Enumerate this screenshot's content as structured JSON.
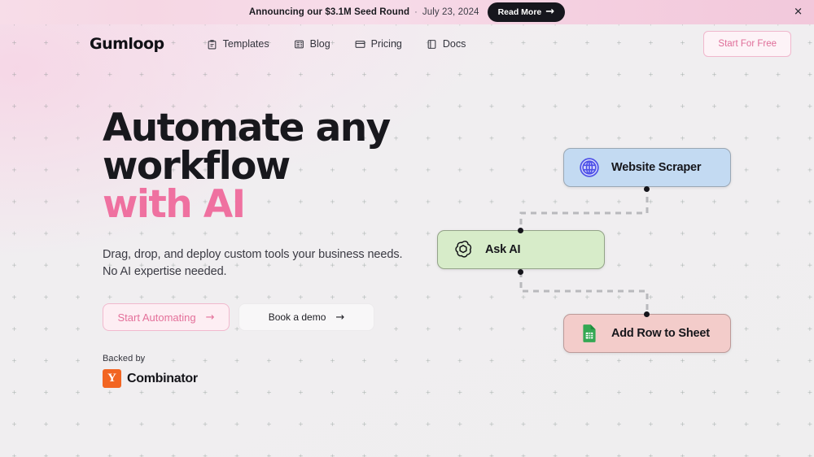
{
  "banner": {
    "text": "Announcing our $3.1M Seed Round",
    "separator": "·",
    "date": "July 23, 2024",
    "cta_label": "Read More",
    "cta_arrow": "→",
    "close_label": "✕"
  },
  "nav": {
    "logo": "Gumloop",
    "links": [
      {
        "label": "Templates",
        "icon": "clipboard-icon"
      },
      {
        "label": "Blog",
        "icon": "newspaper-icon"
      },
      {
        "label": "Pricing",
        "icon": "credit-card-icon"
      },
      {
        "label": "Docs",
        "icon": "book-icon"
      }
    ],
    "cta_label": "Start For Free"
  },
  "hero": {
    "headline_line1": "Automate any",
    "headline_line2": "workflow",
    "headline_accent": "with AI",
    "subhead_line1": "Drag, drop, and deploy custom tools your business needs.",
    "subhead_line2": "No AI expertise needed.",
    "primary_cta": "Start Automating",
    "primary_cta_arrow": "→",
    "secondary_cta": "Book a demo",
    "secondary_cta_arrow": "→",
    "backed_by_label": "Backed by",
    "yc_mark": "Y",
    "yc_name": "Combinator"
  },
  "workflow": {
    "nodes": [
      {
        "id": "website-scraper",
        "label": "Website Scraper",
        "icon": "globe-icon",
        "color": "#c3daf2"
      },
      {
        "id": "ask-ai",
        "label": "Ask AI",
        "icon": "openai-icon",
        "color": "#d7ecc9"
      },
      {
        "id": "add-row-to-sheet",
        "label": "Add Row to Sheet",
        "icon": "google-sheets-icon",
        "color": "#f3ccca"
      }
    ]
  },
  "colors": {
    "accent_pink": "#ef71a0",
    "banner_pink": "#f6d7e4",
    "yc_orange": "#f26522",
    "text_dark": "#18181d"
  }
}
